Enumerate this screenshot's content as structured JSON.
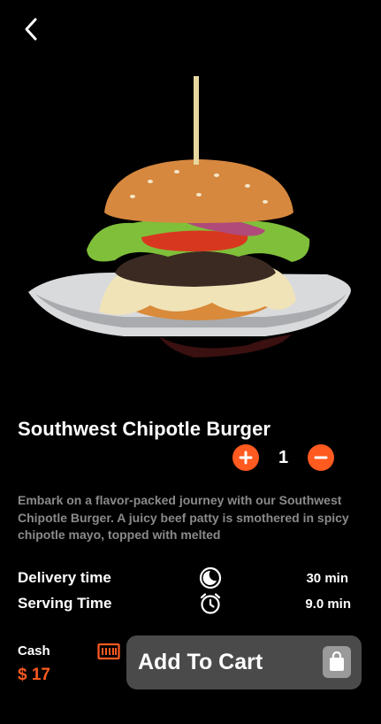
{
  "header": {
    "back_icon": "chevron-left-icon"
  },
  "product": {
    "image_alt": "burger-image",
    "name": "Southwest Chipotle Burger",
    "quantity": "1",
    "description": "Embark on a flavor-packed journey with our Southwest Chipotle Burger. A juicy beef patty is smothered in spicy chipotle mayo, topped with melted"
  },
  "info": {
    "delivery_label": "Delivery time",
    "delivery_value": "30 min",
    "serving_label": "Serving Time",
    "serving_value": "9.0 min"
  },
  "payment": {
    "cash_label": "Cash",
    "price": "$ 17"
  },
  "cart": {
    "label": "Add To Cart"
  },
  "colors": {
    "accent": "#ff5a1f",
    "background": "#000000",
    "button_bg": "#4a4a4a"
  }
}
